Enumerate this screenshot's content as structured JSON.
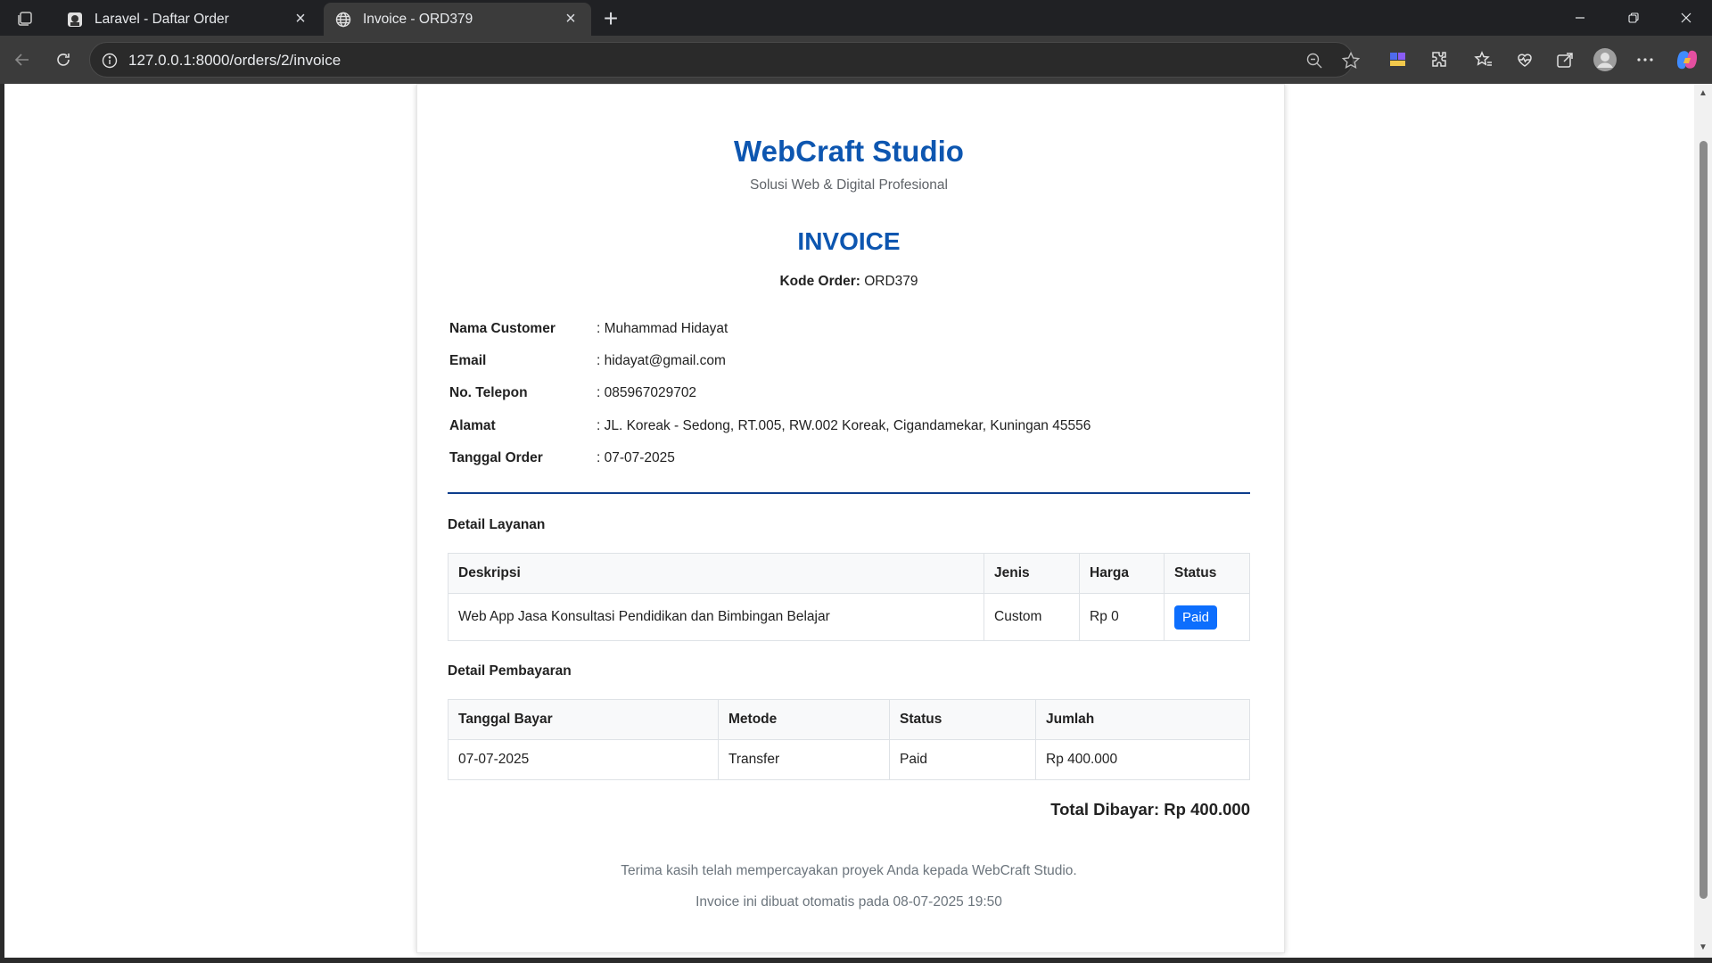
{
  "browser": {
    "tabs": [
      {
        "title": "Laravel - Daftar Order"
      },
      {
        "title": "Invoice - ORD379"
      }
    ],
    "url": "127.0.0.1:8000/orders/2/invoice"
  },
  "invoice": {
    "company": "WebCraft Studio",
    "tagline": "Solusi Web & Digital Profesional",
    "title": "INVOICE",
    "order_code_label": "Kode Order:",
    "order_code": "ORD379",
    "customer": [
      {
        "label": "Nama Customer",
        "value": ": Muhammad Hidayat"
      },
      {
        "label": "Email",
        "value": ": hidayat@gmail.com"
      },
      {
        "label": "No. Telepon",
        "value": ": 085967029702"
      },
      {
        "label": "Alamat",
        "value": ": JL. Koreak - Sedong, RT.005, RW.002 Koreak, Cigandamekar, Kuningan 45556"
      },
      {
        "label": "Tanggal Order",
        "value": ": 07-07-2025"
      }
    ],
    "services_title": "Detail Layanan",
    "services_headers": [
      "Deskripsi",
      "Jenis",
      "Harga",
      "Status"
    ],
    "services_rows": [
      {
        "deskripsi": "Web App Jasa Konsultasi Pendidikan dan Bimbingan Belajar",
        "jenis": "Custom",
        "harga": "Rp 0",
        "status": "Paid"
      }
    ],
    "payments_title": "Detail Pembayaran",
    "payments_headers": [
      "Tanggal Bayar",
      "Metode",
      "Status",
      "Jumlah"
    ],
    "payments_rows": [
      {
        "tanggal": "07-07-2025",
        "metode": "Transfer",
        "status": "Paid",
        "jumlah": "Rp 400.000"
      }
    ],
    "total": "Total Dibayar: Rp 400.000",
    "thanks": "Terima kasih telah mempercayakan proyek Anda kepada WebCraft Studio.",
    "generated": "Invoice ini dibuat otomatis pada 08-07-2025 19:50"
  }
}
